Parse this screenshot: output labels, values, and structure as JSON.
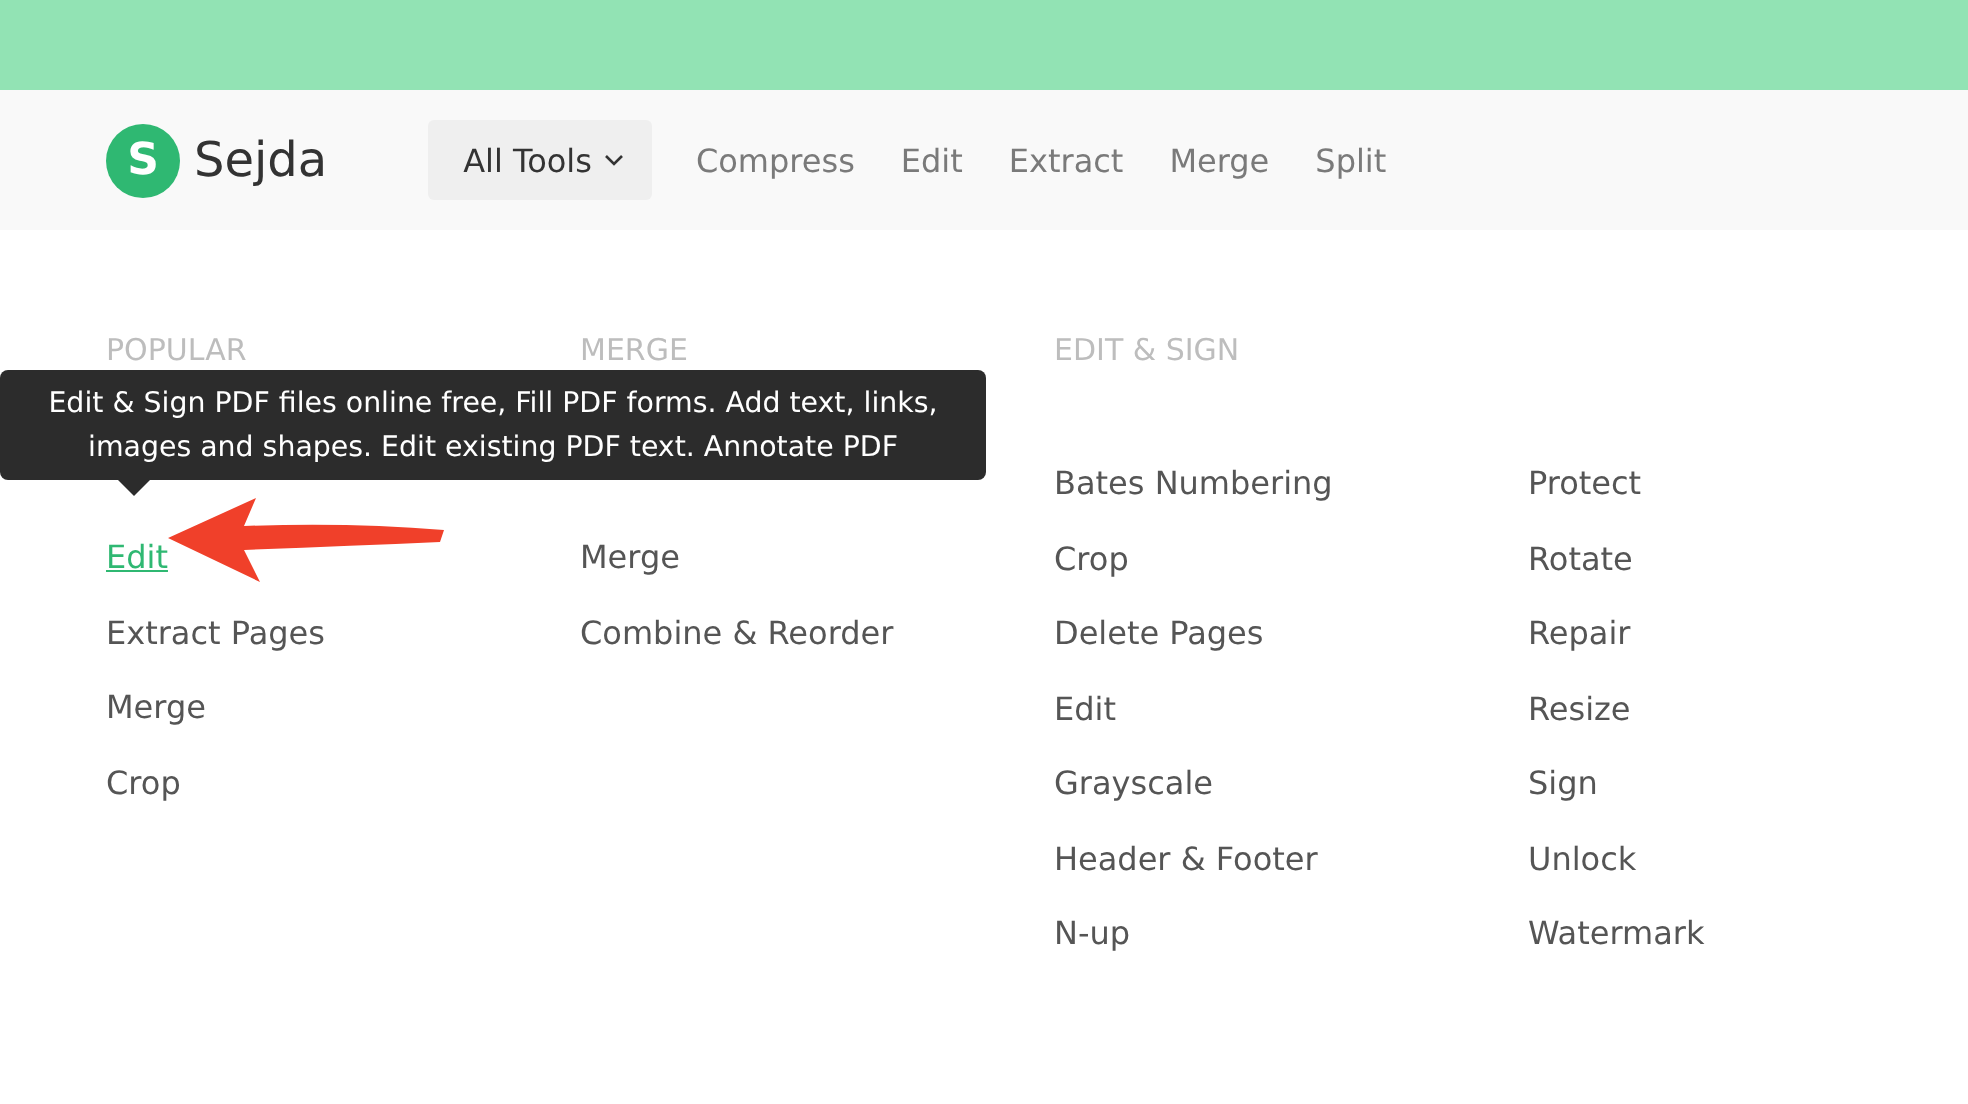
{
  "header": {
    "logo_letter": "S",
    "brand": "Sejda",
    "all_tools": "All Tools",
    "links": [
      "Compress",
      "Edit",
      "Extract",
      "Merge",
      "Split"
    ]
  },
  "tooltip": {
    "text": "Edit & Sign PDF files online free, Fill PDF forms. Add text, links, images and shapes. Edit existing PDF text. Annotate PDF"
  },
  "sections": [
    {
      "heading": "POPULAR",
      "columns": [
        [
          {
            "label": "Edit",
            "selected": true
          },
          {
            "label": "Extract Pages",
            "selected": false
          },
          {
            "label": "Merge",
            "selected": false
          },
          {
            "label": "Crop",
            "selected": false
          }
        ]
      ]
    },
    {
      "heading": "MERGE",
      "columns": [
        [
          {
            "label": "Merge",
            "selected": false
          },
          {
            "label": "Combine & Reorder",
            "selected": false
          }
        ]
      ]
    },
    {
      "heading": "EDIT & SIGN",
      "columns": [
        [
          {
            "label": "Bates Numbering",
            "selected": false
          },
          {
            "label": "Crop",
            "selected": false
          },
          {
            "label": "Delete Pages",
            "selected": false
          },
          {
            "label": "Edit",
            "selected": false
          },
          {
            "label": "Grayscale",
            "selected": false
          },
          {
            "label": "Header & Footer",
            "selected": false
          },
          {
            "label": "N-up",
            "selected": false
          }
        ],
        [
          {
            "label": "Protect",
            "selected": false
          },
          {
            "label": "Rotate",
            "selected": false
          },
          {
            "label": "Repair",
            "selected": false
          },
          {
            "label": "Resize",
            "selected": false
          },
          {
            "label": "Sign",
            "selected": false
          },
          {
            "label": "Unlock",
            "selected": false
          },
          {
            "label": "Watermark",
            "selected": false
          }
        ]
      ]
    }
  ]
}
